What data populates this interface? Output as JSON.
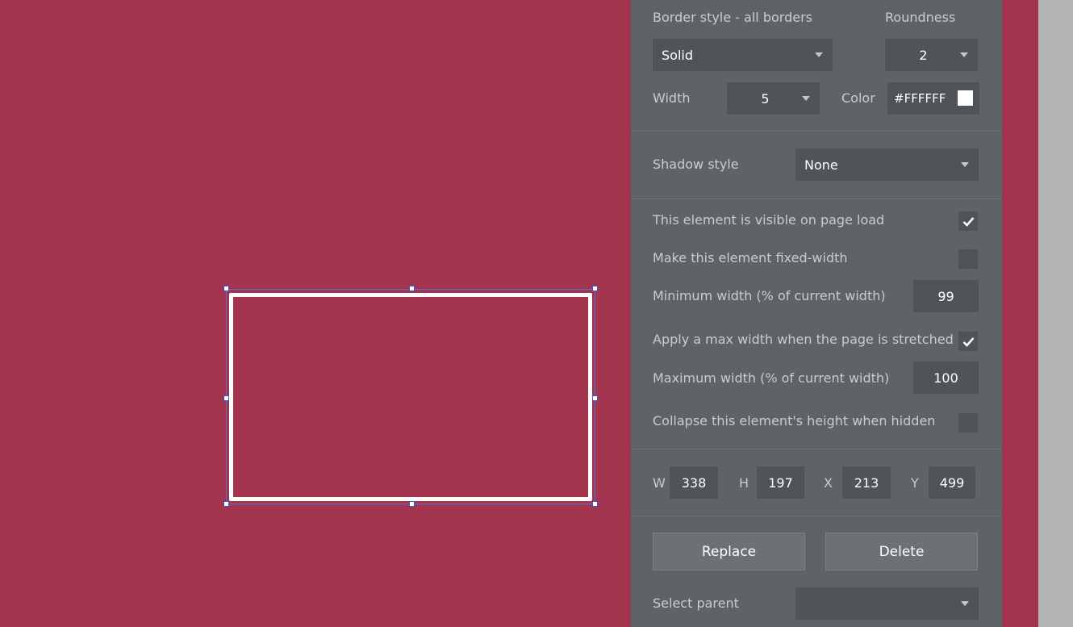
{
  "border": {
    "style_label": "Border style - all borders",
    "roundness_label": "Roundness",
    "style_value": "Solid",
    "roundness_value": "2",
    "width_label": "Width",
    "width_value": "5",
    "color_label": "Color",
    "color_value": "#FFFFFF",
    "color_swatch": "#FFFFFF"
  },
  "shadow": {
    "label": "Shadow style",
    "value": "None"
  },
  "visibility": {
    "visible_on_load_label": "This element is visible on page load",
    "visible_on_load_checked": true,
    "fixed_width_label": "Make this element fixed-width",
    "fixed_width_checked": false,
    "min_width_label": "Minimum width (% of current width)",
    "min_width_value": "99",
    "max_width_apply_label": "Apply a max width when the page is stretched",
    "max_width_apply_checked": true,
    "max_width_label": "Maximum width (% of current width)",
    "max_width_value": "100",
    "collapse_label": "Collapse this element's height when hidden",
    "collapse_checked": false
  },
  "dimensions": {
    "w_label": "W",
    "w_value": "338",
    "h_label": "H",
    "h_value": "197",
    "x_label": "X",
    "x_value": "213",
    "y_label": "Y",
    "y_value": "499"
  },
  "actions": {
    "replace_label": "Replace",
    "delete_label": "Delete"
  },
  "parent": {
    "label": "Select parent",
    "value": ""
  },
  "colors": {
    "canvas_bg": "#A3344D",
    "panel_bg": "#5E6366",
    "selection_handle": "#3D55C9"
  },
  "icons": [
    "checkmark-icon",
    "caret-down-icon"
  ]
}
